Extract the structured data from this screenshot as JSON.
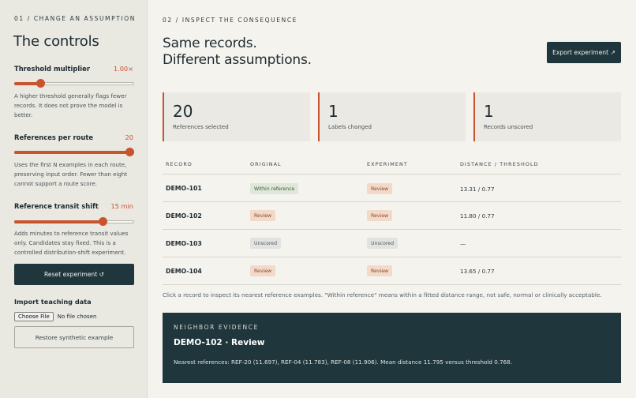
{
  "sidebar": {
    "eyebrow": "01 / CHANGE AN ASSUMPTION",
    "title": "The controls",
    "threshold": {
      "label": "Threshold multiplier",
      "value": "1.00×",
      "fraction": 0.22,
      "help": "A higher threshold generally flags fewer records. It does not prove the model is better."
    },
    "references": {
      "label": "References per route",
      "value": "20",
      "fraction": 1.0,
      "help": "Uses the first N examples in each route, preserving input order. Fewer than eight cannot support a route score."
    },
    "transit": {
      "label": "Reference transit shift",
      "value": "15 min",
      "fraction": 0.74,
      "help": "Adds minutes to reference transit values only. Candidates stay fixed. This is a controlled distribution-shift experiment."
    },
    "reset_label": "Reset experiment ↺",
    "import_label": "Import teaching data",
    "choose_file_label": "Choose File",
    "no_file_label": "No file chosen",
    "restore_label": "Restore synthetic example"
  },
  "main": {
    "eyebrow": "02 / INSPECT THE CONSEQUENCE",
    "headline_line1": "Same records.",
    "headline_line2": "Different assumptions.",
    "export_label": "Export experiment ↗",
    "stats": [
      {
        "value": "20",
        "label": "References selected"
      },
      {
        "value": "1",
        "label": "Labels changed"
      },
      {
        "value": "1",
        "label": "Records unscored"
      }
    ],
    "table": {
      "headers": [
        "RECORD",
        "ORIGINAL",
        "EXPERIMENT",
        "DISTANCE / THRESHOLD"
      ],
      "rows": [
        {
          "record": "DEMO-101",
          "original": "Within reference",
          "experiment": "Review",
          "distance": "13.31 / 0.77"
        },
        {
          "record": "DEMO-102",
          "original": "Review",
          "experiment": "Review",
          "distance": "11.80 / 0.77"
        },
        {
          "record": "DEMO-103",
          "original": "Unscored",
          "experiment": "Unscored",
          "distance": "—"
        },
        {
          "record": "DEMO-104",
          "original": "Review",
          "experiment": "Review",
          "distance": "13.65 / 0.77"
        }
      ]
    },
    "note": "Click a record to inspect its nearest reference examples. \"Within reference\" means within a fitted distance range, not safe, normal or clinically acceptable.",
    "evidence": {
      "eyebrow": "NEIGHBOR EVIDENCE",
      "title": "DEMO-102 · Review",
      "body": "Nearest references: REF-20 (11.697), REF-04 (11.783), REF-08 (11.906). Mean distance 11.795 versus threshold 0.768."
    }
  },
  "colors": {
    "accent": "#c8532f",
    "dark": "#1f363c",
    "sidebar_bg": "#e9e8e1",
    "page_bg": "#f4f3ee"
  }
}
